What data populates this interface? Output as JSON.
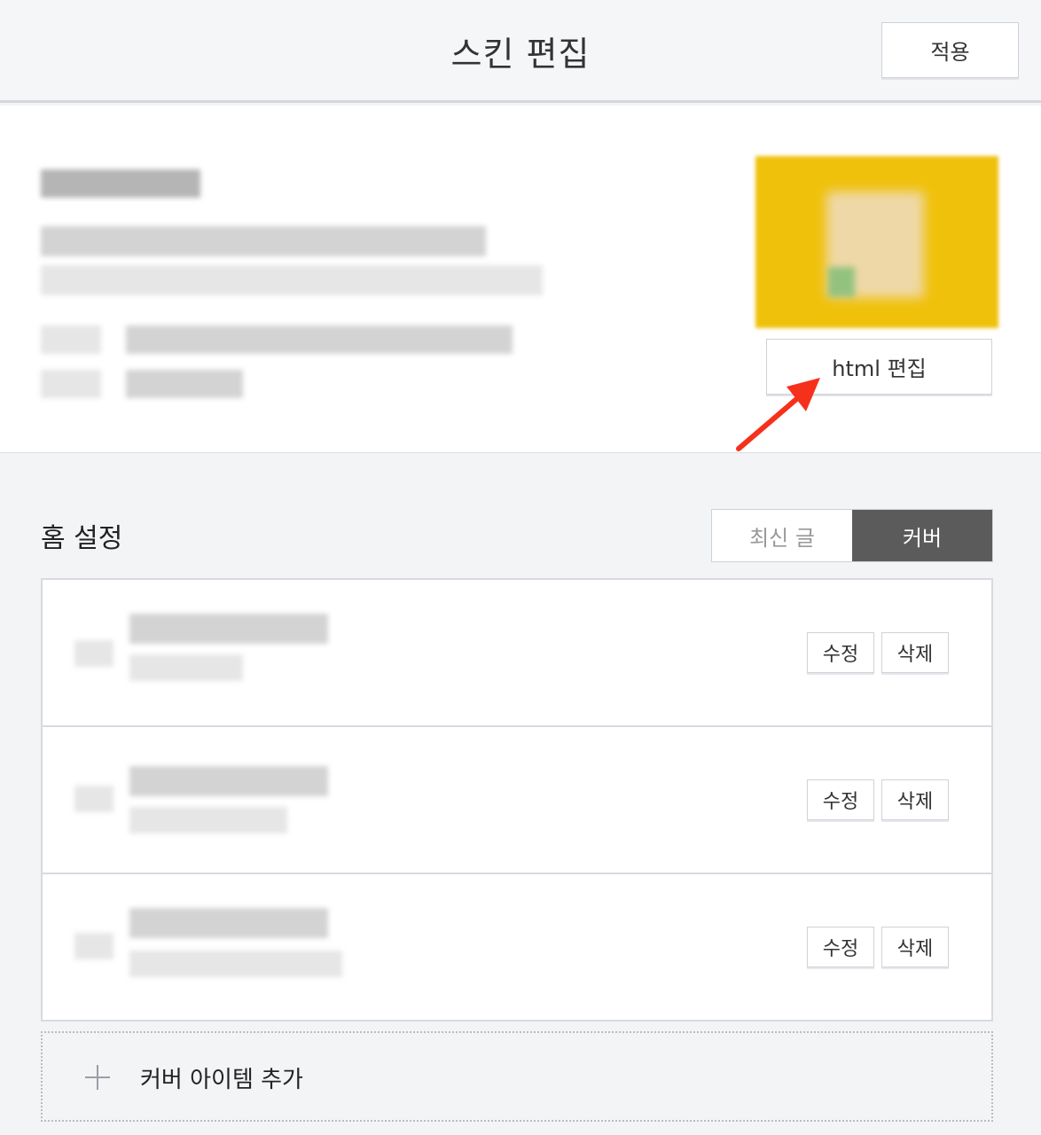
{
  "header": {
    "title": "스킨 편집",
    "apply_label": "적용"
  },
  "profile": {
    "html_edit_label": "html 편집"
  },
  "home": {
    "title": "홈 설정",
    "toggle": {
      "options": [
        "최신 글",
        "커버"
      ],
      "selected": "커버"
    },
    "items": [
      {
        "edit_label": "수정",
        "delete_label": "삭제"
      },
      {
        "edit_label": "수정",
        "delete_label": "삭제"
      },
      {
        "edit_label": "수정",
        "delete_label": "삭제"
      }
    ],
    "add_cover_label": "커버 아이템 추가"
  },
  "colors": {
    "accent_arrow": "#f5311c",
    "toggle_active": "#5b5b5b",
    "thumbnail": "#f0c10a"
  }
}
